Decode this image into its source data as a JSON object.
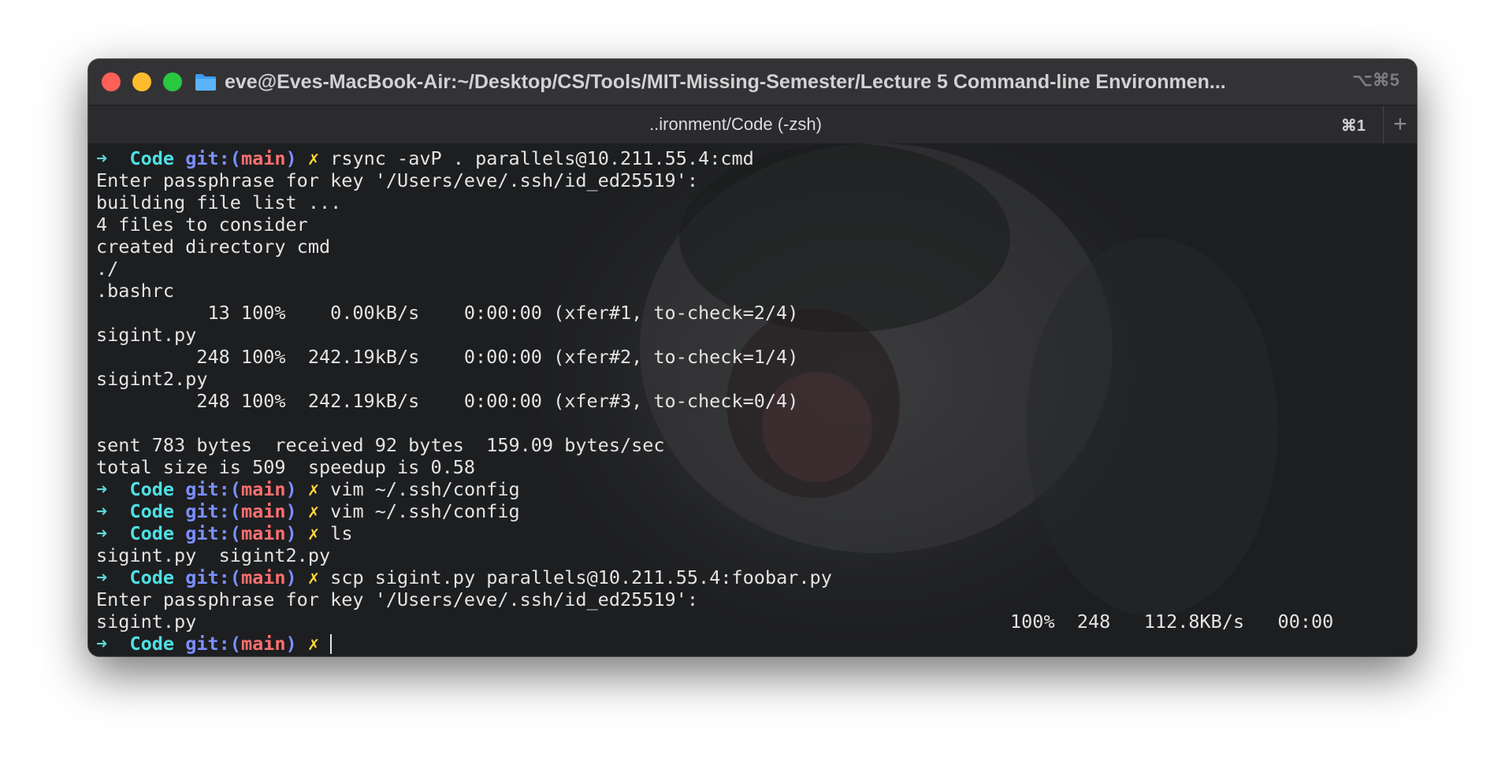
{
  "window": {
    "title": "eve@Eves-MacBook-Air:~/Desktop/CS/Tools/MIT-Missing-Semester/Lecture 5 Command-line Environmen...",
    "shortcut": "⌥⌘5",
    "folder_icon": "folder-icon"
  },
  "tab": {
    "title": "..ironment/Code (-zsh)",
    "shortcut": "⌘1",
    "new_tab_label": "+"
  },
  "prompt": {
    "arrow": "➜",
    "dir": "Code",
    "git_label": "git:",
    "branch_open": "(",
    "branch": "main",
    "branch_close": ")",
    "dirty_mark": "✗"
  },
  "colors": {
    "prompt_arrow": "#5fd7d7",
    "dir": "#4fe0e3",
    "git": "#7b8fff",
    "branch": "#ff6f6f",
    "dirty": "#ffd93b",
    "text": "#e4e4e4"
  },
  "lines": [
    {
      "type": "prompt",
      "cmd": "rsync -avP . parallels@10.211.55.4:cmd"
    },
    {
      "type": "out",
      "text": "Enter passphrase for key '/Users/eve/.ssh/id_ed25519':"
    },
    {
      "type": "out",
      "text": "building file list ..."
    },
    {
      "type": "out",
      "text": "4 files to consider"
    },
    {
      "type": "out",
      "text": "created directory cmd"
    },
    {
      "type": "out",
      "text": "./"
    },
    {
      "type": "out",
      "text": ".bashrc"
    },
    {
      "type": "out",
      "text": "          13 100%    0.00kB/s    0:00:00 (xfer#1, to-check=2/4)"
    },
    {
      "type": "out",
      "text": "sigint.py"
    },
    {
      "type": "out",
      "text": "         248 100%  242.19kB/s    0:00:00 (xfer#2, to-check=1/4)"
    },
    {
      "type": "out",
      "text": "sigint2.py"
    },
    {
      "type": "out",
      "text": "         248 100%  242.19kB/s    0:00:00 (xfer#3, to-check=0/4)"
    },
    {
      "type": "out",
      "text": ""
    },
    {
      "type": "out",
      "text": "sent 783 bytes  received 92 bytes  159.09 bytes/sec"
    },
    {
      "type": "out",
      "text": "total size is 509  speedup is 0.58"
    },
    {
      "type": "prompt",
      "cmd": "vim ~/.ssh/config"
    },
    {
      "type": "prompt",
      "cmd": "vim ~/.ssh/config"
    },
    {
      "type": "prompt",
      "cmd": "ls"
    },
    {
      "type": "out",
      "text": "sigint.py  sigint2.py"
    },
    {
      "type": "prompt",
      "cmd": "scp sigint.py parallels@10.211.55.4:foobar.py"
    },
    {
      "type": "out",
      "text": "Enter passphrase for key '/Users/eve/.ssh/id_ed25519':"
    },
    {
      "type": "progress",
      "text": "sigint.py",
      "right": "100%  248   112.8KB/s   00:00"
    },
    {
      "type": "prompt",
      "cmd": "",
      "cursor": true
    }
  ]
}
